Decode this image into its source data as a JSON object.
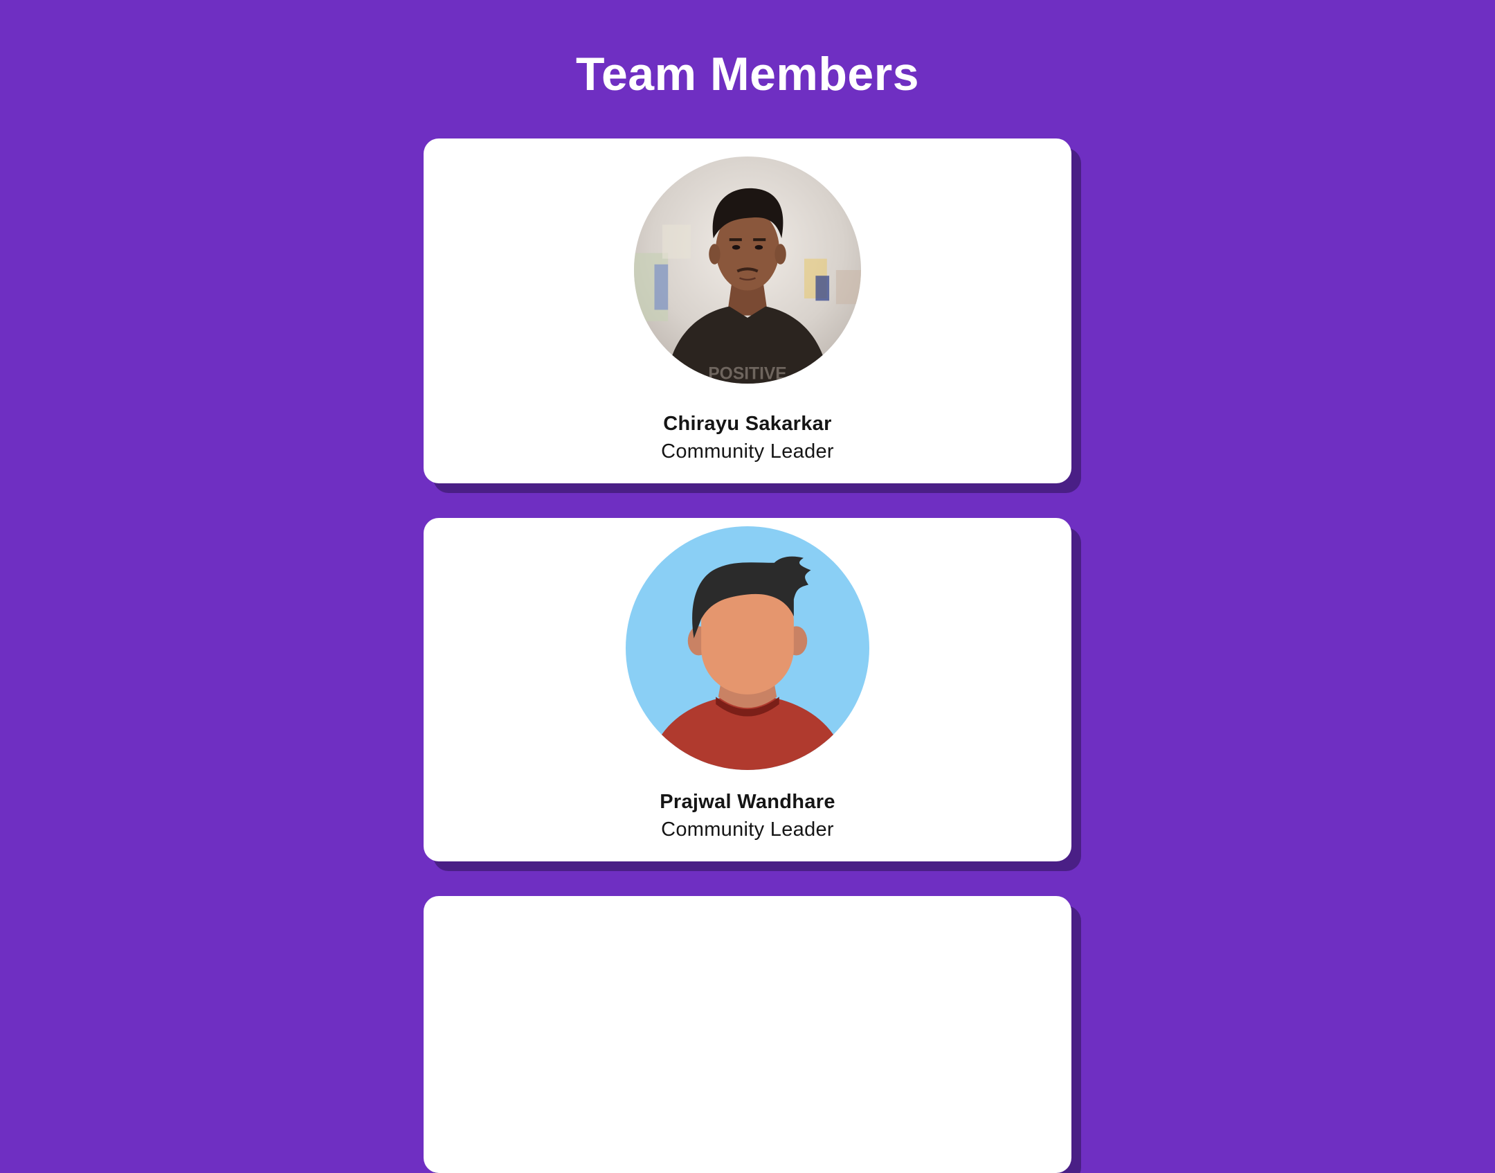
{
  "page": {
    "title": "Team Members",
    "background_color": "#6f2fc2",
    "shadow_color": "#4a1f86"
  },
  "members": [
    {
      "name": "Chirayu Sakarkar",
      "role": "Community Leader",
      "avatar": "photo-avatar-icon",
      "shirt_text": "POSITIVE"
    },
    {
      "name": "Prajwal Wandhare",
      "role": "Community Leader",
      "avatar": "cartoon-avatar-icon"
    }
  ]
}
